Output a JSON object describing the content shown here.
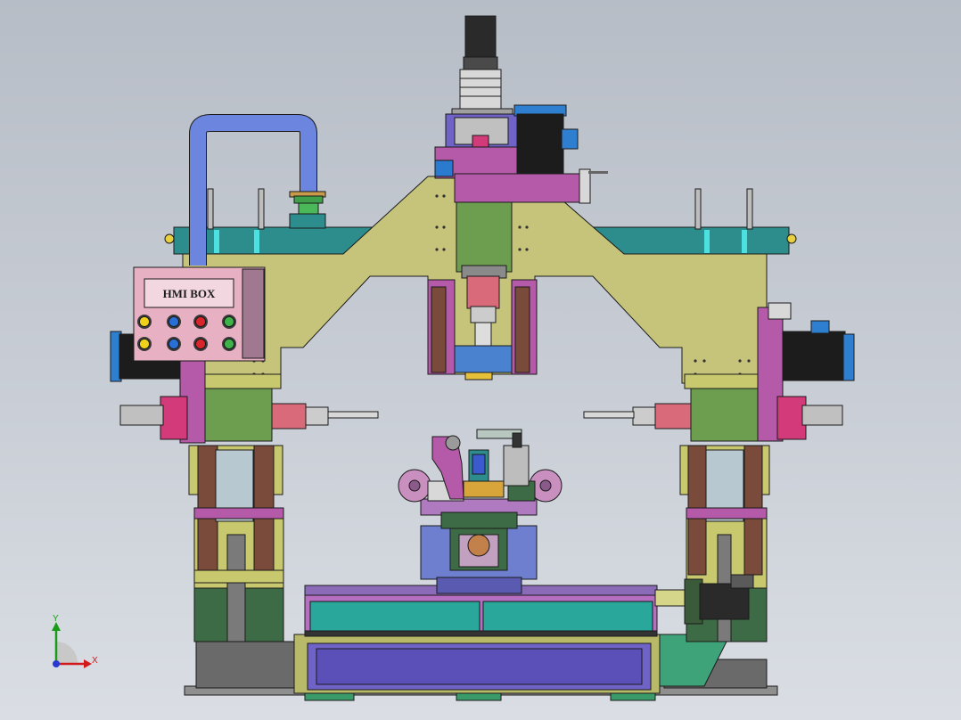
{
  "hmi_box": {
    "label": "HMI BOX"
  },
  "triad": {
    "y_label": "Y",
    "x_label": "X"
  },
  "colors": {
    "background": "#c3c8d0",
    "frame": "#bdbd6c",
    "gantry": "#c6c47a",
    "magenta": "#b45aa8",
    "green": "#6d9e50",
    "teal": "#2d8d8d",
    "motor_blue": "#2f7fd0",
    "pipe_blue": "#5f7fd6",
    "violet": "#6f63c8",
    "dark_green": "#3c6b45",
    "pink_box": "#e7b0c3",
    "rail_green": "#3a9a8a"
  },
  "buttons": [
    {
      "name": "yellow",
      "color": "#f0d21a"
    },
    {
      "name": "blue",
      "color": "#2a6fd6"
    },
    {
      "name": "red",
      "color": "#d8252a"
    },
    {
      "name": "green",
      "color": "#3fb24a"
    }
  ]
}
